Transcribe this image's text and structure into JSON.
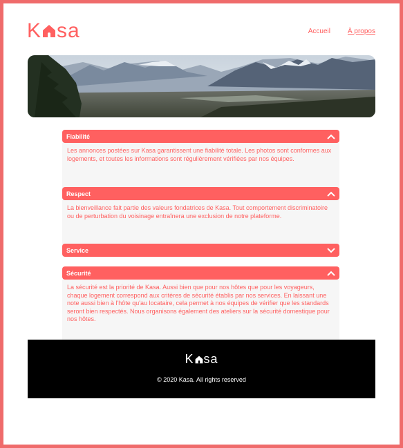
{
  "header": {
    "logo_left": "K",
    "logo_right": "sa",
    "nav": [
      {
        "label": "Accueil"
      },
      {
        "label": "À propos"
      }
    ]
  },
  "banner": {
    "icon": "mountain-landscape"
  },
  "accordions": [
    {
      "title": "Fiabilité",
      "expanded": true,
      "body": "Les annonces postées sur Kasa garantissent une fiabilité totale. Les photos sont conformes aux logements, et toutes les informations sont régulièrement vérifiées par nos équipes."
    },
    {
      "title": "Respect",
      "expanded": true,
      "body": "La bienveillance fait partie des valeurs fondatrices de Kasa. Tout comportement discriminatoire ou de perturbation du voisinage entraînera une exclusion de notre plateforme."
    },
    {
      "title": "Service",
      "expanded": false,
      "body": ""
    },
    {
      "title": "Sécurité",
      "expanded": true,
      "body": "La sécurité est la priorité de Kasa. Aussi bien que pour nos hôtes que pour les voyageurs, chaque logement correspond aux critères de sécurité établis par nos services. En laissant une note aussi bien à l'hôte qu'au locataire, cela permet à nos équipes de vérifier que les standards seront bien respectés. Nous organisons également des ateliers sur la sécurité domestique pour nos hôtes."
    }
  ],
  "footer": {
    "logo_left": "K",
    "logo_right": "sa",
    "copyright": "© 2020 Kasa. All rights reserved"
  },
  "colors": {
    "accent": "#FF6060",
    "panel": "#F6F6F6",
    "footer": "#000000"
  }
}
